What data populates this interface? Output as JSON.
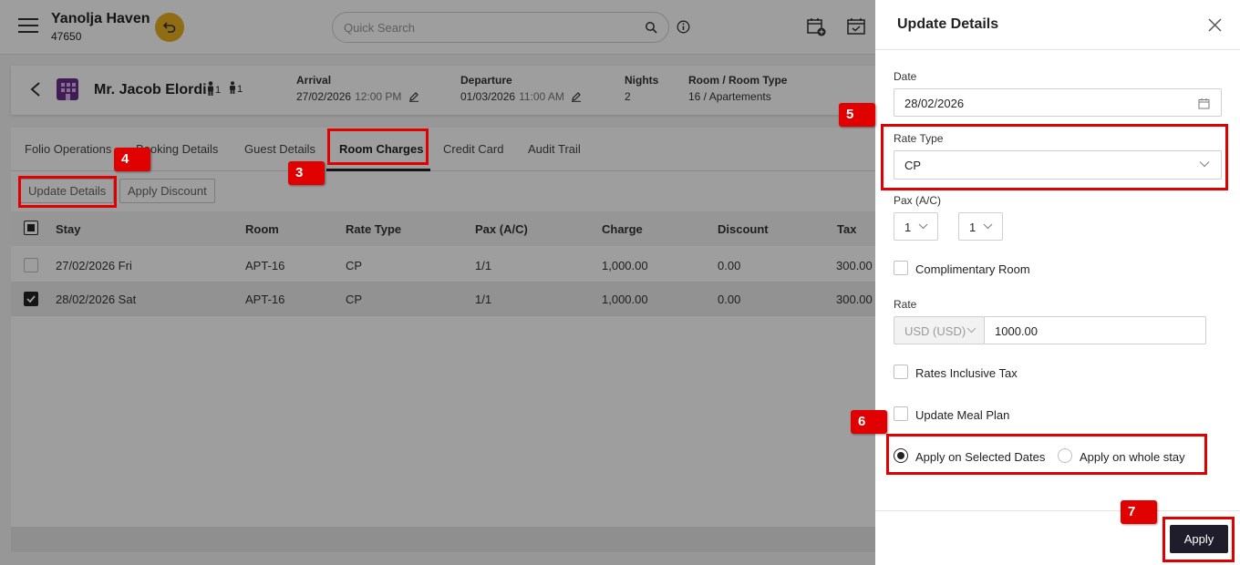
{
  "topbar": {
    "hotel_name": "Yanolja Haven",
    "hotel_code": "47650",
    "search_placeholder": "Quick Search"
  },
  "guest": {
    "name": "Mr. Jacob Elordi",
    "adults": "1",
    "children": "1",
    "arrival_label": "Arrival",
    "arrival_date": "27/02/2026",
    "arrival_time": "12:00 PM",
    "departure_label": "Departure",
    "departure_date": "01/03/2026",
    "departure_time": "11:00 AM",
    "nights_label": "Nights",
    "nights_value": "2",
    "room_label": "Room / Room Type",
    "room_value": "16 / Apartements"
  },
  "tabs": [
    {
      "label": "Folio Operations"
    },
    {
      "label": "Booking Details"
    },
    {
      "label": "Guest Details"
    },
    {
      "label": "Room Charges"
    },
    {
      "label": "Credit Card"
    },
    {
      "label": "Audit Trail"
    }
  ],
  "actions": {
    "update_details": "Update Details",
    "apply_discount": "Apply Discount"
  },
  "table": {
    "headers": [
      "Stay",
      "Room",
      "Rate Type",
      "Pax (A/C)",
      "Charge",
      "Discount",
      "Tax"
    ],
    "rows": [
      {
        "stay": "27/02/2026 Fri",
        "room": "APT-16",
        "rate_type": "CP",
        "pax": "1/1",
        "charge": "1,000.00",
        "discount": "0.00",
        "tax": "300.00",
        "checked": false
      },
      {
        "stay": "28/02/2026 Sat",
        "room": "APT-16",
        "rate_type": "CP",
        "pax": "1/1",
        "charge": "1,000.00",
        "discount": "0.00",
        "tax": "300.00",
        "checked": true
      }
    ]
  },
  "drawer": {
    "title": "Update Details",
    "date_label": "Date",
    "date_value": "28/02/2026",
    "rate_type_label": "Rate Type",
    "rate_type_value": "CP",
    "pax_label": "Pax (A/C)",
    "pax_adults": "1",
    "pax_children": "1",
    "complimentary_label": "Complimentary Room",
    "rate_label": "Rate",
    "currency_value": "USD (USD)",
    "rate_value": "1000.00",
    "rates_inclusive_label": "Rates Inclusive Tax",
    "update_meal_label": "Update Meal Plan",
    "apply_selected_label": "Apply on Selected Dates",
    "apply_whole_label": "Apply on whole stay",
    "apply_button": "Apply"
  },
  "annotations": [
    "3",
    "4",
    "5",
    "6",
    "7"
  ],
  "colors": {
    "highlight": "#e00000",
    "primary_button": "#1f1d2b",
    "accent_yellow": "#e8b021",
    "building_icon": "#6b2e8a"
  }
}
